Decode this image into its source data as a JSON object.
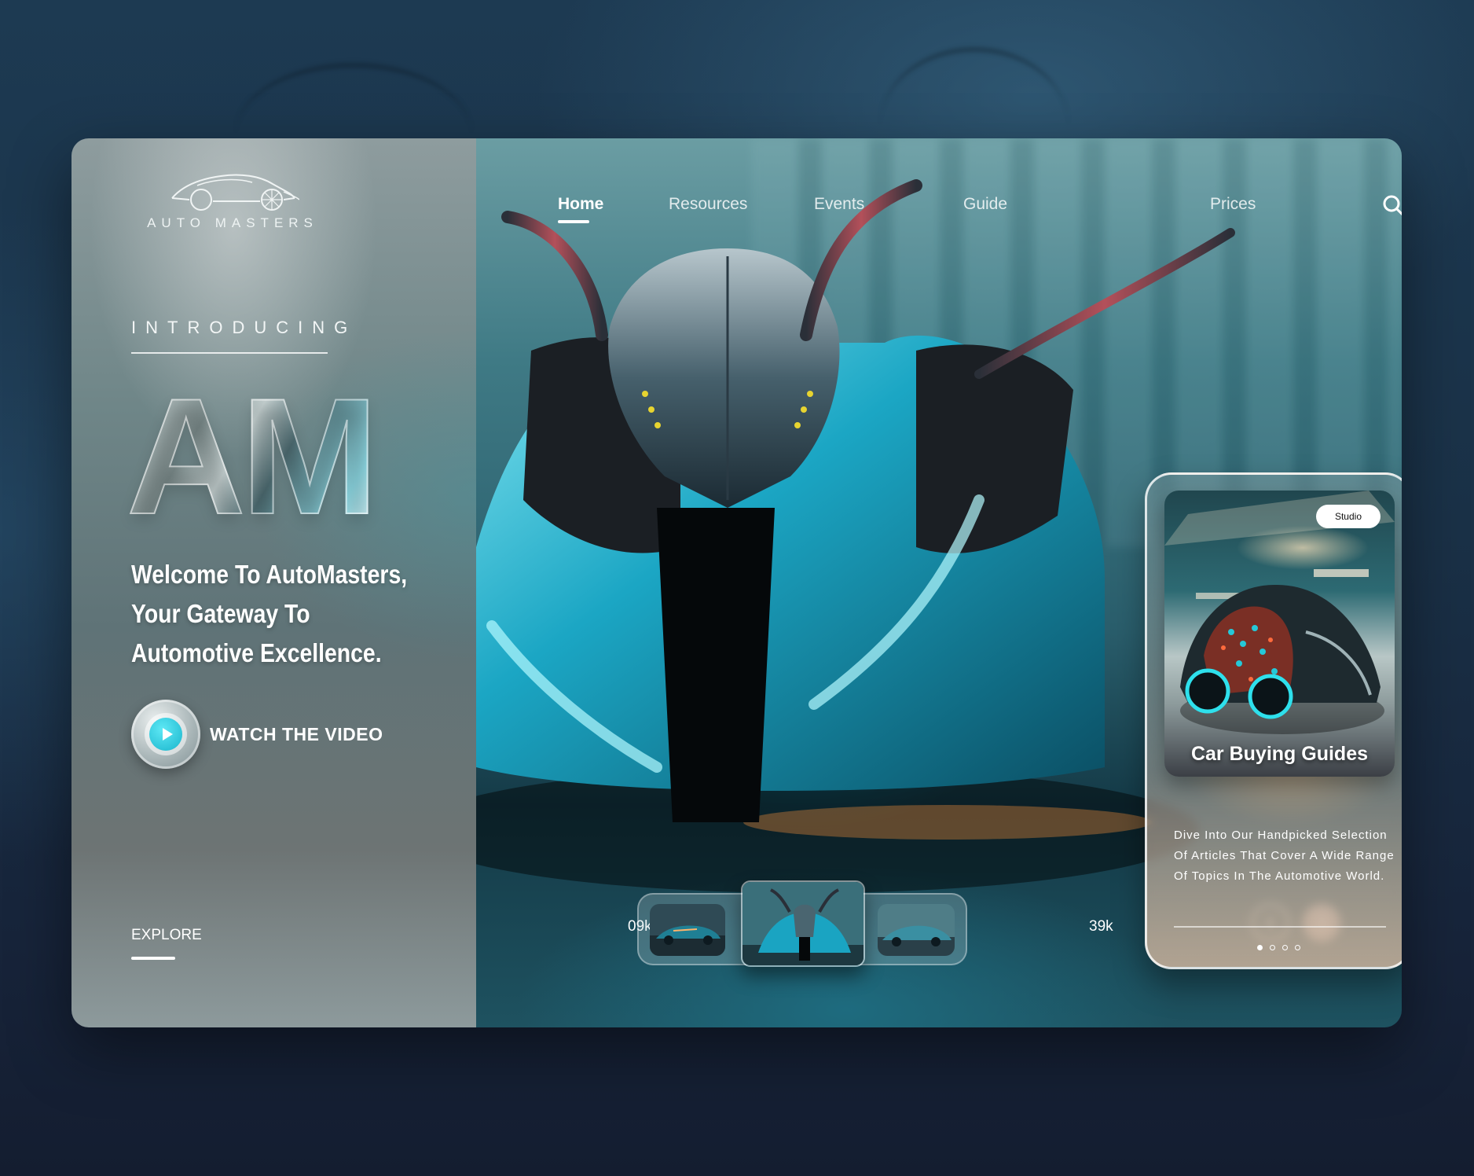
{
  "brand": {
    "name": "AUTO MASTERS"
  },
  "nav": {
    "items": [
      {
        "label": "Home",
        "active": true
      },
      {
        "label": "Resources",
        "active": false
      },
      {
        "label": "Events",
        "active": false
      },
      {
        "label": "Guide",
        "active": false
      },
      {
        "label": "Prices",
        "active": false
      }
    ],
    "search_icon": "search-icon"
  },
  "hero": {
    "eyebrow": "INTRODUCING",
    "monogram": "AM",
    "headline": "Welcome To AutoMasters, Your Gateway To Automotive Excellence.",
    "cta_label": "WATCH THE VIDEO",
    "explore_label": "EXPLORE"
  },
  "card": {
    "badge": "Studio",
    "title": "Car Buying Guides",
    "description": "Dive Into Our Handpicked Selection Of Articles That Cover A Wide Range Of Topics In The Automotive World.",
    "pager": {
      "total": 4,
      "active_index": 0
    }
  },
  "carousel": {
    "left_count": "09k",
    "right_count": "39k",
    "active_index": 1,
    "prev_icon": "chevron-left-icon",
    "next_icon": "chevron-right-icon"
  },
  "colors": {
    "accent": "#1fc3da",
    "text": "#ffffff"
  }
}
